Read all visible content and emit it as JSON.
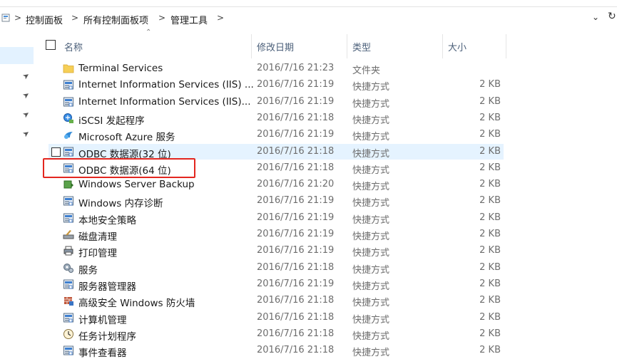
{
  "breadcrumb": {
    "items": [
      "控制面板",
      "所有控制面板项",
      "管理工具"
    ],
    "separator": ">"
  },
  "columns": {
    "name": "名称",
    "date": "修改日期",
    "type": "类型",
    "size": "大小"
  },
  "files": [
    {
      "name": "Terminal Services",
      "date": "2016/7/16 21:23",
      "type": "文件夹",
      "size": "",
      "icon": "folder-icon"
    },
    {
      "name": "Internet Information Services (IIS) ...",
      "date": "2016/7/16 21:19",
      "type": "快捷方式",
      "size": "2 KB",
      "icon": "iis-icon"
    },
    {
      "name": "Internet Information Services (IIS)...",
      "date": "2016/7/16 21:19",
      "type": "快捷方式",
      "size": "2 KB",
      "icon": "iis-manager-icon"
    },
    {
      "name": "iSCSI 发起程序",
      "date": "2016/7/16 21:18",
      "type": "快捷方式",
      "size": "2 KB",
      "icon": "iscsi-icon"
    },
    {
      "name": "Microsoft Azure 服务",
      "date": "2016/7/16 21:19",
      "type": "快捷方式",
      "size": "2 KB",
      "icon": "azure-icon"
    },
    {
      "name": "ODBC 数据源(32 位)",
      "date": "2016/7/16 21:18",
      "type": "快捷方式",
      "size": "2 KB",
      "icon": "odbc-icon"
    },
    {
      "name": "ODBC 数据源(64 位)",
      "date": "2016/7/16 21:18",
      "type": "快捷方式",
      "size": "2 KB",
      "icon": "odbc-icon"
    },
    {
      "name": "Windows Server Backup",
      "date": "2016/7/16 21:20",
      "type": "快捷方式",
      "size": "2 KB",
      "icon": "backup-icon"
    },
    {
      "name": "Windows 内存诊断",
      "date": "2016/7/16 21:19",
      "type": "快捷方式",
      "size": "2 KB",
      "icon": "memory-diagnostic-icon"
    },
    {
      "name": "本地安全策略",
      "date": "2016/7/16 21:19",
      "type": "快捷方式",
      "size": "2 KB",
      "icon": "security-policy-icon"
    },
    {
      "name": "磁盘清理",
      "date": "2016/7/16 21:19",
      "type": "快捷方式",
      "size": "2 KB",
      "icon": "disk-cleanup-icon"
    },
    {
      "name": "打印管理",
      "date": "2016/7/16 21:19",
      "type": "快捷方式",
      "size": "2 KB",
      "icon": "printer-icon"
    },
    {
      "name": "服务",
      "date": "2016/7/16 21:18",
      "type": "快捷方式",
      "size": "2 KB",
      "icon": "services-icon"
    },
    {
      "name": "服务器管理器",
      "date": "2016/7/16 21:19",
      "type": "快捷方式",
      "size": "2 KB",
      "icon": "server-manager-icon"
    },
    {
      "name": "高级安全 Windows 防火墙",
      "date": "2016/7/16 21:18",
      "type": "快捷方式",
      "size": "2 KB",
      "icon": "firewall-icon"
    },
    {
      "name": "计算机管理",
      "date": "2016/7/16 21:18",
      "type": "快捷方式",
      "size": "2 KB",
      "icon": "computer-management-icon"
    },
    {
      "name": "任务计划程序",
      "date": "2016/7/16 21:18",
      "type": "快捷方式",
      "size": "2 KB",
      "icon": "task-scheduler-icon"
    },
    {
      "name": "事件查看器",
      "date": "2016/7/16 21:18",
      "type": "快捷方式",
      "size": "2 KB",
      "icon": "event-viewer-icon"
    }
  ],
  "hovered_index": 5,
  "annotated_index": 6,
  "colors": {
    "hover": "#e5f3ff",
    "annotation_box": "#e3261f",
    "header_text": "#4c607a",
    "secondary_text": "#6d6d6d"
  }
}
